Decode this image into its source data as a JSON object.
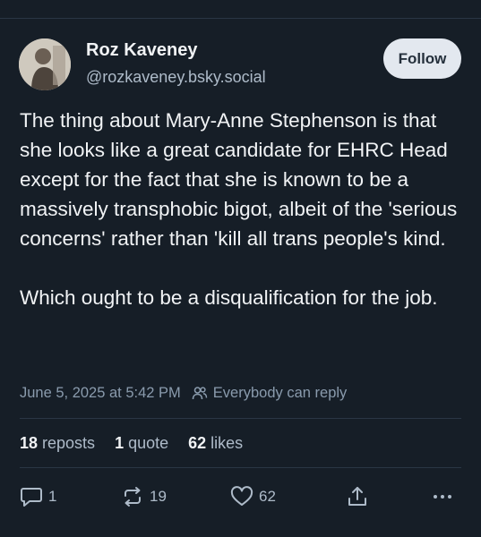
{
  "author": {
    "name": "Roz Kaveney",
    "handle": "@rozkaveney.bsky.social"
  },
  "follow_label": "Follow",
  "post": {
    "text": "The thing about Mary-Anne Stephenson is that she looks like a great candidate for EHRC Head except for the fact that she is known to be a massively transphobic bigot, albeit of the 'serious concerns' rather than 'kill all trans people's kind.\n\nWhich ought to be a disqualification for the job.",
    "timestamp": "June 5, 2025 at 5:42 PM",
    "reply_setting": "Everybody can reply"
  },
  "stats": {
    "reposts_count": "18",
    "reposts_label": "reposts",
    "quotes_count": "1",
    "quotes_label": "quote",
    "likes_count": "62",
    "likes_label": "likes"
  },
  "actions": {
    "reply_count": "1",
    "repost_count": "19",
    "like_count": "62"
  },
  "icons": {
    "reply": "reply-icon",
    "repost": "repost-icon",
    "like": "heart-icon",
    "share": "share-icon",
    "more": "more-icon",
    "reply_setting": "people-icon"
  },
  "colors": {
    "background": "#161e27",
    "text_primary": "#f1f3f5",
    "text_secondary": "#aebbc9",
    "meta_text": "#8a9bad",
    "follow_button_bg": "#e3e8ef"
  }
}
